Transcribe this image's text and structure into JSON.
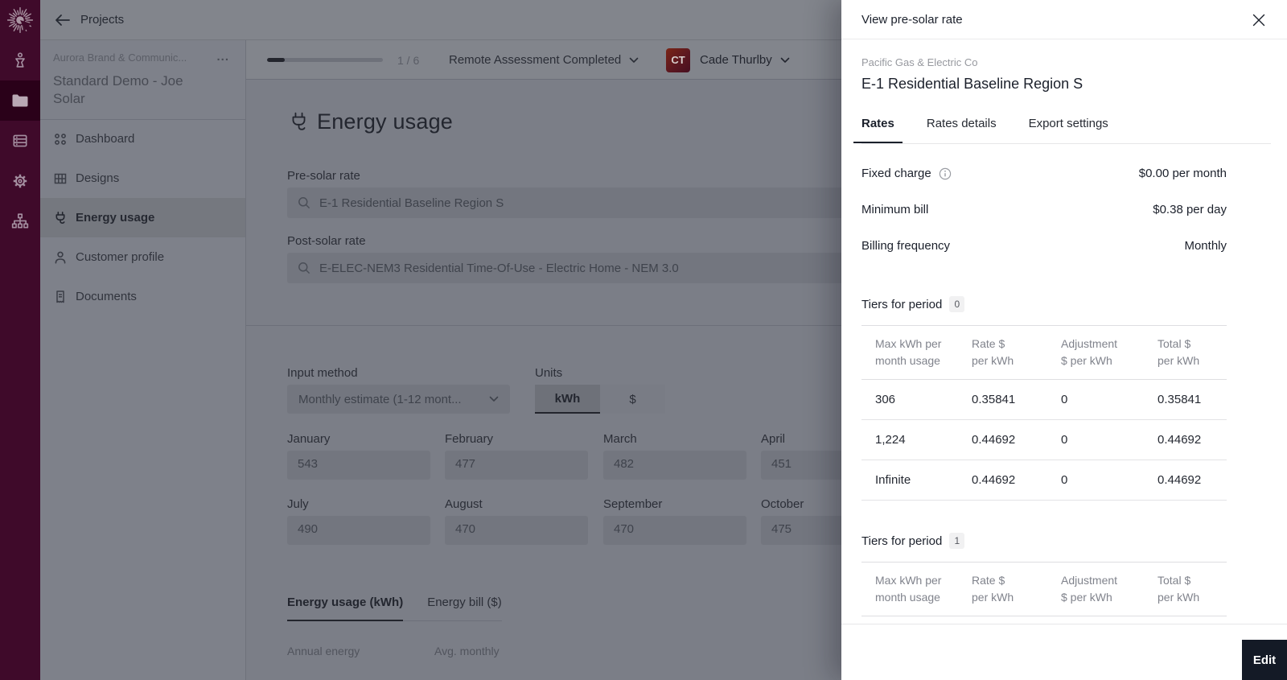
{
  "colors": {
    "brand_plum": "#3F0A2A",
    "brand_plum_active": "#2A0119",
    "dim_surface": "#7B7E87",
    "panel_bg": "#FFFFFF",
    "accent_dark": "#141A26",
    "avatar_gradient_from": "#7A2516",
    "avatar_gradient_to": "#470F20"
  },
  "appbar": {
    "back_label": "Projects"
  },
  "rail": {
    "icons": [
      "aurora-logo",
      "leads",
      "projects-folder",
      "database",
      "settings-gear",
      "org-chart"
    ],
    "active_icon": "projects-folder"
  },
  "sidebar": {
    "org_name": "Aurora Brand & Communic...",
    "org_menu": "...",
    "project_title": "Standard Demo - Joe Solar",
    "items": [
      {
        "label": "Dashboard",
        "icon": "dashboard-dots"
      },
      {
        "label": "Designs",
        "icon": "designs-grid"
      },
      {
        "label": "Energy usage",
        "icon": "plug",
        "active": true
      },
      {
        "label": "Customer profile",
        "icon": "person"
      },
      {
        "label": "Documents",
        "icon": "document"
      }
    ]
  },
  "subheader": {
    "progress_label": "1 / 6",
    "progress_current": 1,
    "progress_total": 6,
    "status_label": "Remote Assessment Completed",
    "user_initials": "CT",
    "user_name": "Cade Thurlby"
  },
  "main": {
    "title": "Energy usage",
    "pre_solar": {
      "label": "Pre-solar rate",
      "value": "E-1 Residential Baseline Region S"
    },
    "post_solar": {
      "label": "Post-solar rate",
      "value": "E-ELEC-NEM3 Residential Time-Of-Use - Electric Home - NEM 3.0"
    },
    "input_method": {
      "label": "Input method",
      "value": "Monthly estimate (1-12 mont..."
    },
    "units": {
      "label": "Units",
      "options": [
        "kWh",
        "$"
      ],
      "selected": "kWh"
    },
    "months": [
      {
        "label": "January",
        "value": "543"
      },
      {
        "label": "February",
        "value": "477"
      },
      {
        "label": "March",
        "value": "482"
      },
      {
        "label": "April",
        "value": "451"
      },
      {
        "label": "July",
        "value": "490"
      },
      {
        "label": "August",
        "value": "470"
      },
      {
        "label": "September",
        "value": "470"
      },
      {
        "label": "October",
        "value": "475"
      }
    ],
    "tabs": [
      {
        "label": "Energy usage (kWh)",
        "active": true
      },
      {
        "label": "Energy bill ($)",
        "active": false
      }
    ],
    "stats": [
      {
        "label": "Annual energy"
      },
      {
        "label": "Avg. monthly"
      }
    ]
  },
  "panel": {
    "title": "View pre-solar rate",
    "utility": "Pacific Gas & Electric Co",
    "rate_name": "E-1 Residential Baseline Region S",
    "tabs": [
      {
        "label": "Rates",
        "active": true
      },
      {
        "label": "Rates details",
        "active": false
      },
      {
        "label": "Export settings",
        "active": false
      }
    ],
    "summary": [
      {
        "label": "Fixed charge",
        "info": true,
        "value": "$0.00 per month"
      },
      {
        "label": "Minimum bill",
        "info": false,
        "value": "$0.38 per day"
      },
      {
        "label": "Billing frequency",
        "info": false,
        "value": "Monthly"
      }
    ],
    "tiers": [
      {
        "heading": "Tiers for period",
        "badge": "0",
        "columns": [
          [
            "Max kWh per",
            "month usage"
          ],
          [
            "Rate $",
            "per kWh"
          ],
          [
            "Adjustment",
            "$ per kWh"
          ],
          [
            "Total $",
            "per kWh"
          ]
        ],
        "rows": [
          [
            "306",
            "0.35841",
            "0",
            "0.35841"
          ],
          [
            "1,224",
            "0.44692",
            "0",
            "0.44692"
          ],
          [
            "Infinite",
            "0.44692",
            "0",
            "0.44692"
          ]
        ]
      },
      {
        "heading": "Tiers for period",
        "badge": "1",
        "columns": [
          [
            "Max kWh per",
            "month usage"
          ],
          [
            "Rate $",
            "per kWh"
          ],
          [
            "Adjustment",
            "$ per kWh"
          ],
          [
            "Total $",
            "per kWh"
          ]
        ],
        "rows": []
      }
    ],
    "edit_label": "Edit"
  }
}
